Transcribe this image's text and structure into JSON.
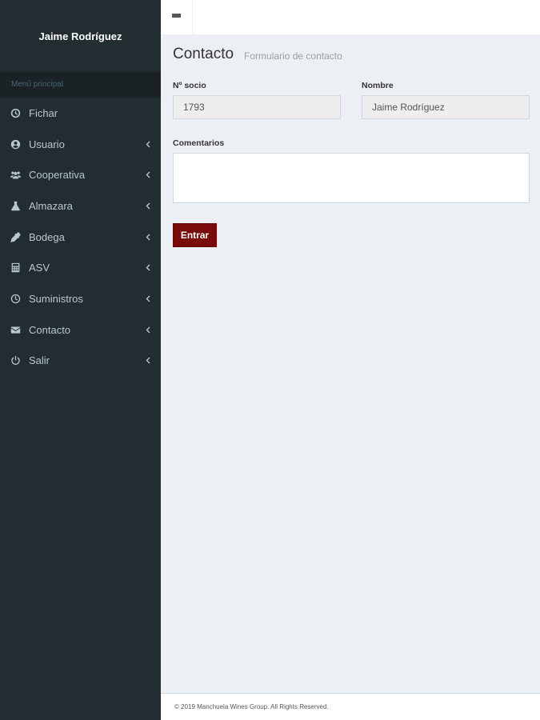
{
  "sidebar": {
    "user_name": "Jaime Rodríguez",
    "menu_header": "Menú principal",
    "items": [
      {
        "label": "Fichar",
        "icon": "clock-circle-icon",
        "has_chevron": false
      },
      {
        "label": "Usuario",
        "icon": "user-circle-icon",
        "has_chevron": true
      },
      {
        "label": "Cooperativa",
        "icon": "users-icon",
        "has_chevron": true
      },
      {
        "label": "Almazara",
        "icon": "flask-icon",
        "has_chevron": true
      },
      {
        "label": "Bodega",
        "icon": "eyedropper-icon",
        "has_chevron": true
      },
      {
        "label": "ASV",
        "icon": "calculator-icon",
        "has_chevron": true
      },
      {
        "label": "Suministros",
        "icon": "clock-icon",
        "has_chevron": true
      },
      {
        "label": "Contacto",
        "icon": "envelope-icon",
        "has_chevron": true
      },
      {
        "label": "Salir",
        "icon": "power-icon",
        "has_chevron": true
      }
    ]
  },
  "topbar": {
    "toggle_icon": "hamburger-icon"
  },
  "page": {
    "title": "Contacto",
    "subtitle": "Formulario de contacto"
  },
  "form": {
    "socio_label": "Nº socio",
    "socio_value": "1793",
    "nombre_label": "Nombre",
    "nombre_value": "Jaime Rodríguez",
    "comentarios_label": "Comentarios",
    "comentarios_value": "",
    "submit_label": "Entrar"
  },
  "colors": {
    "sidebar_bg": "#222d32",
    "content_bg": "#ecf0f5",
    "submit_bg": "#7a0b0b"
  },
  "footer": {
    "text": "© 2019 Manchuela Wines Group. All Rights Reserved."
  }
}
